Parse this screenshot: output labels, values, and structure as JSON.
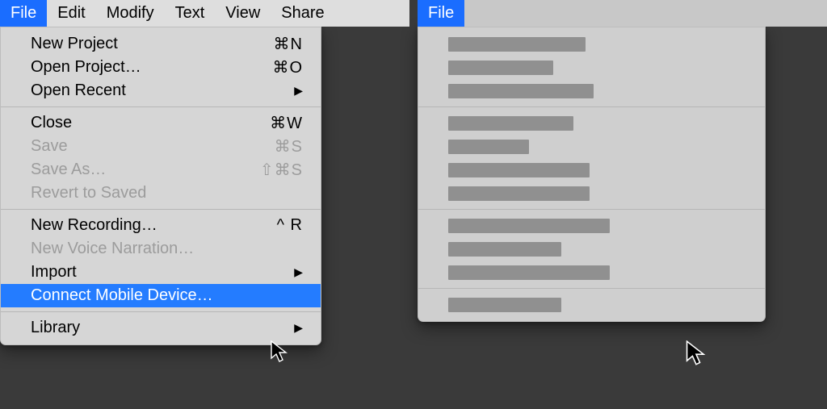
{
  "menubar": {
    "items": [
      {
        "label": "File",
        "active": true
      },
      {
        "label": "Edit"
      },
      {
        "label": "Modify"
      },
      {
        "label": "Text"
      },
      {
        "label": "View"
      },
      {
        "label": "Share"
      }
    ]
  },
  "file_menu": {
    "groups": [
      [
        {
          "label": "New Project",
          "shortcut": "⌘N"
        },
        {
          "label": "Open Project…",
          "shortcut": "⌘O"
        },
        {
          "label": "Open Recent",
          "submenu": true
        }
      ],
      [
        {
          "label": "Close",
          "shortcut": "⌘W"
        },
        {
          "label": "Save",
          "shortcut": "⌘S",
          "disabled": true
        },
        {
          "label": "Save As…",
          "shortcut": "⇧⌘S",
          "disabled": true
        },
        {
          "label": "Revert to Saved",
          "disabled": true
        }
      ],
      [
        {
          "label": "New Recording…",
          "shortcut": "^ R"
        },
        {
          "label": "New Voice Narration…",
          "disabled": true
        },
        {
          "label": "Import",
          "submenu": true
        },
        {
          "label": "Connect Mobile Device…",
          "highlight": true,
          "key": "connect-mobile-device"
        }
      ],
      [
        {
          "label": "Library",
          "submenu": true
        }
      ]
    ]
  },
  "right_panel": {
    "menubar_label": "File",
    "placeholder_groups": [
      [
        170,
        130,
        180
      ],
      [
        155,
        100,
        175,
        175
      ],
      [
        200,
        140,
        200
      ],
      [
        140
      ]
    ],
    "highlighted": "Connect Mobile Device…",
    "highlight_group_index": 2,
    "highlight_item_index": 3
  }
}
